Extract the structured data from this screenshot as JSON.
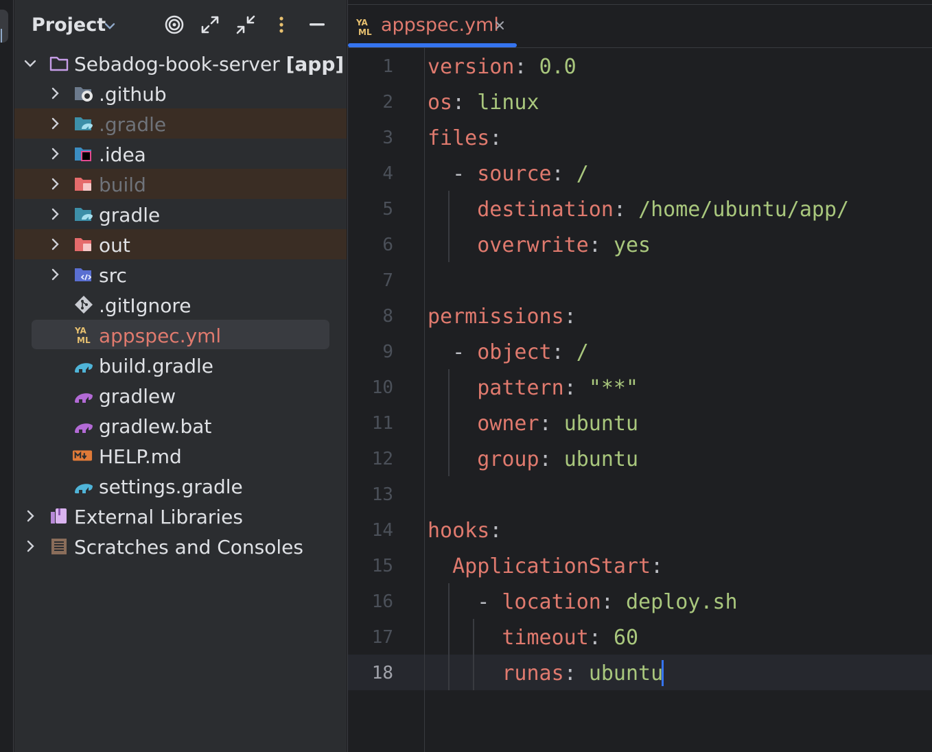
{
  "project_panel": {
    "title": "Project",
    "header_icons": [
      "locate-target-icon",
      "expand-all-icon",
      "collapse-all-icon",
      "more-options-icon",
      "hide-panel-icon"
    ],
    "tree": [
      {
        "label": "Sebadog-book-server",
        "suffix": "[app]",
        "icon": "folder-icon",
        "expanded": true
      },
      {
        "label": ".github",
        "icon": "github-folder-icon"
      },
      {
        "label": ".gradle",
        "icon": "gradle-folder-icon",
        "ignored": true
      },
      {
        "label": ".idea",
        "icon": "idea-folder-icon"
      },
      {
        "label": "build",
        "icon": "excluded-folder-icon",
        "ignored": true
      },
      {
        "label": "gradle",
        "icon": "gradle-folder-icon"
      },
      {
        "label": "out",
        "icon": "excluded-folder-icon",
        "ignored": true
      },
      {
        "label": "src",
        "icon": "source-folder-icon"
      },
      {
        "label": ".gitIgnore",
        "icon": "git-icon"
      },
      {
        "label": "appspec.yml",
        "icon": "yaml-icon",
        "selected": true
      },
      {
        "label": "build.gradle",
        "icon": "gradle-elephant-icon"
      },
      {
        "label": "gradlew",
        "icon": "gradle-elephant-icon"
      },
      {
        "label": "gradlew.bat",
        "icon": "gradle-elephant-icon"
      },
      {
        "label": "HELP.md",
        "icon": "markdown-icon"
      },
      {
        "label": "settings.gradle",
        "icon": "gradle-elephant-icon"
      },
      {
        "label": "External Libraries",
        "icon": "library-icon"
      },
      {
        "label": "Scratches and Consoles",
        "icon": "scratches-icon"
      }
    ]
  },
  "editor": {
    "tab": {
      "label": "appspec.yml",
      "close": "×"
    },
    "current_line": 18,
    "lines": [
      {
        "n": "1",
        "tokens": [
          {
            "k": "version"
          },
          {
            "p": ": "
          },
          {
            "v": "0.0"
          }
        ]
      },
      {
        "n": "2",
        "tokens": [
          {
            "k": "os"
          },
          {
            "p": ": "
          },
          {
            "v": "linux"
          }
        ]
      },
      {
        "n": "3",
        "tokens": [
          {
            "k": "files"
          },
          {
            "p": ":"
          }
        ]
      },
      {
        "n": "4",
        "tokens": [
          {
            "p": "  - "
          },
          {
            "k": "source"
          },
          {
            "p": ": "
          },
          {
            "v": "/"
          }
        ]
      },
      {
        "n": "5",
        "tokens": [
          {
            "p": "    "
          },
          {
            "k": "destination"
          },
          {
            "p": ": "
          },
          {
            "v": "/home/ubuntu/app/"
          }
        ]
      },
      {
        "n": "6",
        "tokens": [
          {
            "p": "    "
          },
          {
            "k": "overwrite"
          },
          {
            "p": ": "
          },
          {
            "v": "yes"
          }
        ]
      },
      {
        "n": "7",
        "tokens": []
      },
      {
        "n": "8",
        "tokens": [
          {
            "k": "permissions"
          },
          {
            "p": ":"
          }
        ]
      },
      {
        "n": "9",
        "tokens": [
          {
            "p": "  - "
          },
          {
            "k": "object"
          },
          {
            "p": ": "
          },
          {
            "v": "/"
          }
        ]
      },
      {
        "n": "10",
        "tokens": [
          {
            "p": "    "
          },
          {
            "k": "pattern"
          },
          {
            "p": ": "
          },
          {
            "v": "\"**\""
          }
        ]
      },
      {
        "n": "11",
        "tokens": [
          {
            "p": "    "
          },
          {
            "k": "owner"
          },
          {
            "p": ": "
          },
          {
            "v": "ubuntu"
          }
        ]
      },
      {
        "n": "12",
        "tokens": [
          {
            "p": "    "
          },
          {
            "k": "group"
          },
          {
            "p": ": "
          },
          {
            "v": "ubuntu"
          }
        ]
      },
      {
        "n": "13",
        "tokens": []
      },
      {
        "n": "14",
        "tokens": [
          {
            "k": "hooks"
          },
          {
            "p": ":"
          }
        ]
      },
      {
        "n": "15",
        "tokens": [
          {
            "p": "  "
          },
          {
            "k": "ApplicationStart"
          },
          {
            "p": ":"
          }
        ]
      },
      {
        "n": "16",
        "tokens": [
          {
            "p": "    - "
          },
          {
            "k": "location"
          },
          {
            "p": ": "
          },
          {
            "v": "deploy.sh"
          }
        ]
      },
      {
        "n": "17",
        "tokens": [
          {
            "p": "      "
          },
          {
            "k": "timeout"
          },
          {
            "p": ": "
          },
          {
            "v": "60"
          }
        ]
      },
      {
        "n": "18",
        "tokens": [
          {
            "p": "      "
          },
          {
            "k": "runas"
          },
          {
            "p": ": "
          },
          {
            "v": "ubuntu"
          }
        ]
      }
    ]
  },
  "colors": {
    "key": "#e07a6e",
    "value": "#a9c77d",
    "accent": "#3574f0",
    "ignored_row": "#3a2d24"
  }
}
